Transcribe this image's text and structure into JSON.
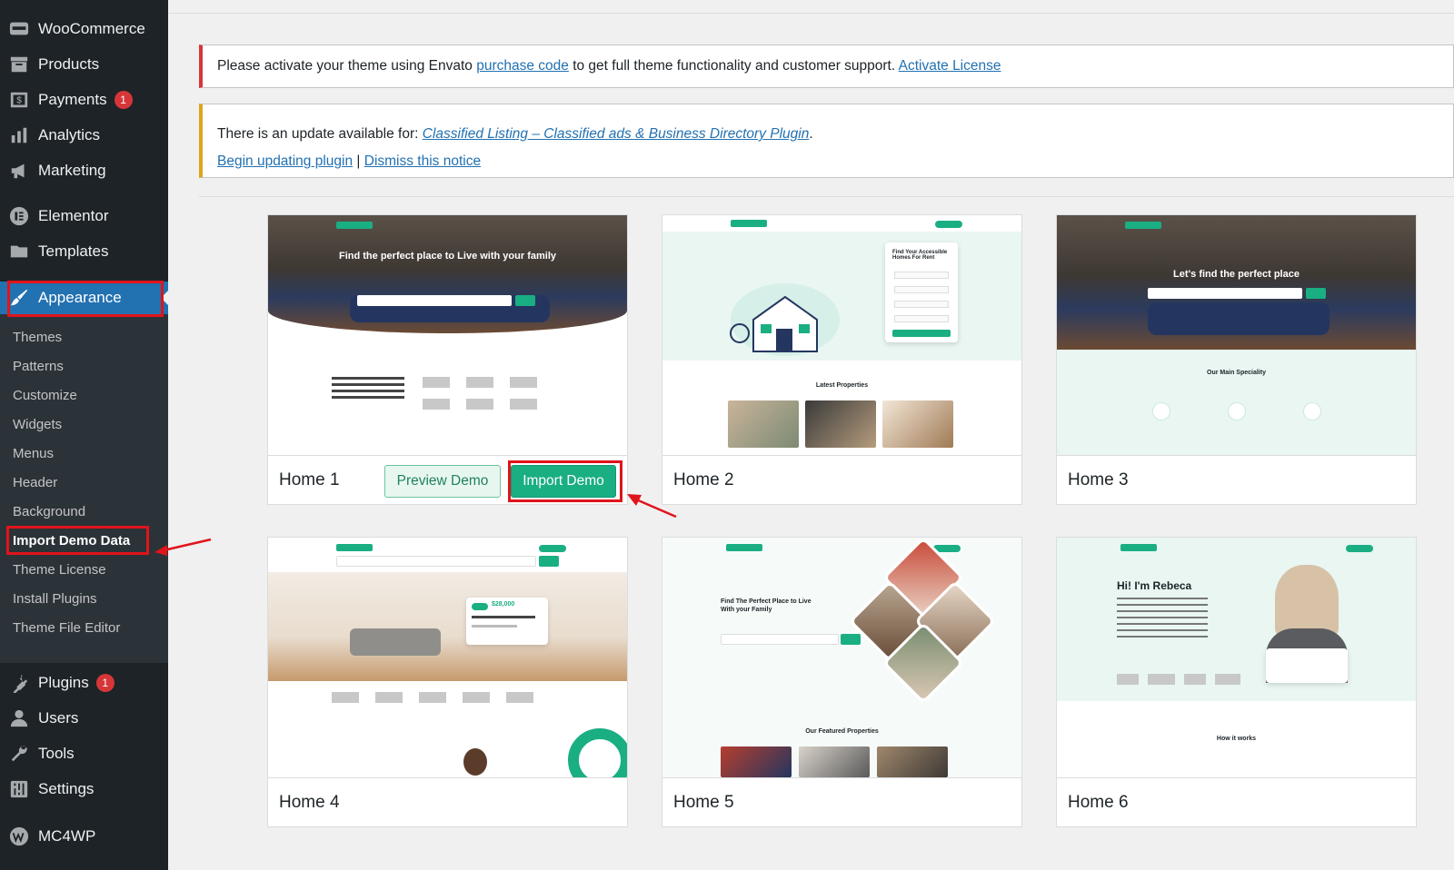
{
  "sidebar": {
    "top_items": [
      {
        "label": "WooCommerce",
        "icon": "woo-icon"
      },
      {
        "label": "Products",
        "icon": "archive-icon"
      },
      {
        "label": "Payments",
        "icon": "payments-icon",
        "badge": "1"
      },
      {
        "label": "Analytics",
        "icon": "bar-chart-icon"
      },
      {
        "label": "Marketing",
        "icon": "megaphone-icon"
      },
      {
        "label": "Elementor",
        "icon": "elementor-icon"
      },
      {
        "label": "Templates",
        "icon": "folder-icon"
      }
    ],
    "appearance": {
      "label": "Appearance",
      "icon": "paintbrush-icon"
    },
    "submenu": [
      "Themes",
      "Patterns",
      "Customize",
      "Widgets",
      "Menus",
      "Header",
      "Background",
      "Import Demo Data",
      "Theme License",
      "Install Plugins",
      "Theme File Editor"
    ],
    "current_submenu": "Import Demo Data",
    "bottom_items": [
      {
        "label": "Plugins",
        "icon": "plug-icon",
        "badge": "1"
      },
      {
        "label": "Users",
        "icon": "user-icon"
      },
      {
        "label": "Tools",
        "icon": "wrench-icon"
      },
      {
        "label": "Settings",
        "icon": "sliders-icon"
      },
      {
        "label": "MC4WP",
        "icon": "mc4wp-icon"
      }
    ]
  },
  "notices": {
    "license": {
      "text_before": "Please activate your theme using Envato ",
      "link_purchase": "purchase code",
      "text_middle": " to get full theme functionality and customer support. ",
      "link_activate": "Activate License"
    },
    "update": {
      "text_before": "There is an update available for: ",
      "plugin_link": "Classified Listing – Classified ads & Business Directory Plugin",
      "text_after": ".",
      "begin_link": "Begin updating plugin",
      "separator": " | ",
      "dismiss_link": "Dismiss this notice"
    }
  },
  "demos": [
    {
      "name": "Home 1",
      "preview_label": "Preview Demo",
      "import_label": "Import Demo",
      "hero_text": "Find the perfect place to Live with your family"
    },
    {
      "name": "Home 2",
      "hero_text": "Find Your Accessible Homes For Rent",
      "section_text": "Latest Properties"
    },
    {
      "name": "Home 3",
      "hero_text": "Let's find the perfect place",
      "section_text": "Our Main Speciality"
    },
    {
      "name": "Home 4",
      "price_text": "$28,000"
    },
    {
      "name": "Home 5",
      "hero_text": "Find The Perfect Place to Live With your Family",
      "section_text": "Our Featured Properties"
    },
    {
      "name": "Home 6",
      "hero_text": "Hi! I'm Rebeca",
      "section_text": "How it works"
    }
  ],
  "colors": {
    "sidebar_bg": "#1d2327",
    "active_menu": "#2271b1",
    "accent_green": "#1aae83",
    "highlight_red": "#e1141b",
    "notice_error": "#d63638",
    "notice_warning": "#dba617"
  }
}
